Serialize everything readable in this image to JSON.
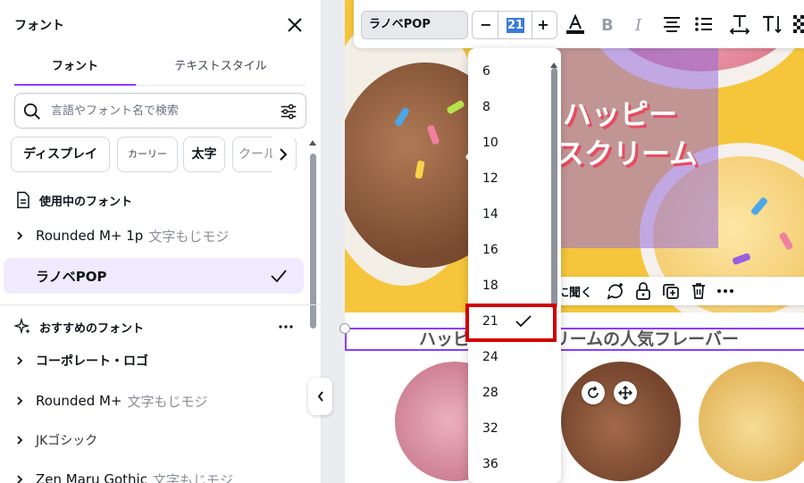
{
  "panel": {
    "title": "フォント",
    "tabs": [
      {
        "label": "フォント",
        "active": true
      },
      {
        "label": "テキストスタイル",
        "active": false
      }
    ],
    "search_placeholder": "言語やフォント名で検索",
    "chips": [
      "ディスプレイ",
      "カーリー",
      "太字",
      "クール"
    ],
    "sections": {
      "in_use_title": "使用中のフォント",
      "recommended_title": "おすすめのフォント"
    },
    "in_use_fonts": [
      {
        "name": "Rounded M+ 1p",
        "sample": "文字もじモジ"
      },
      {
        "name": "ラノベPOP",
        "sample": "",
        "selected": true
      }
    ],
    "recommended_fonts": [
      {
        "name": "コーポレート・ロゴ",
        "sample": ""
      },
      {
        "name": "Rounded M+",
        "sample": "文字もじモジ"
      },
      {
        "name": "JKゴシック",
        "sample": ""
      },
      {
        "name": "Zen Maru Gothic",
        "sample": "文字もじモジ"
      }
    ]
  },
  "toolbar": {
    "font_name": "ラノベPOP",
    "size_minus": "−",
    "size_value": "21",
    "size_plus": "+"
  },
  "size_options": [
    "6",
    "8",
    "10",
    "12",
    "14",
    "16",
    "18",
    "21",
    "24",
    "28",
    "32",
    "36"
  ],
  "selected_size": "21",
  "design": {
    "hero_title_line1": "ハッピー",
    "hero_title_line2": "スクリーム",
    "context_menu_text": "に聞く",
    "subtitle": "ハッピーアイスクリームの人気フレーバー"
  },
  "colors": {
    "accent": "#8b3dff",
    "highlight": "#d10000",
    "selected_row": "#efeafd",
    "hero_bg": "#f5c53c"
  }
}
